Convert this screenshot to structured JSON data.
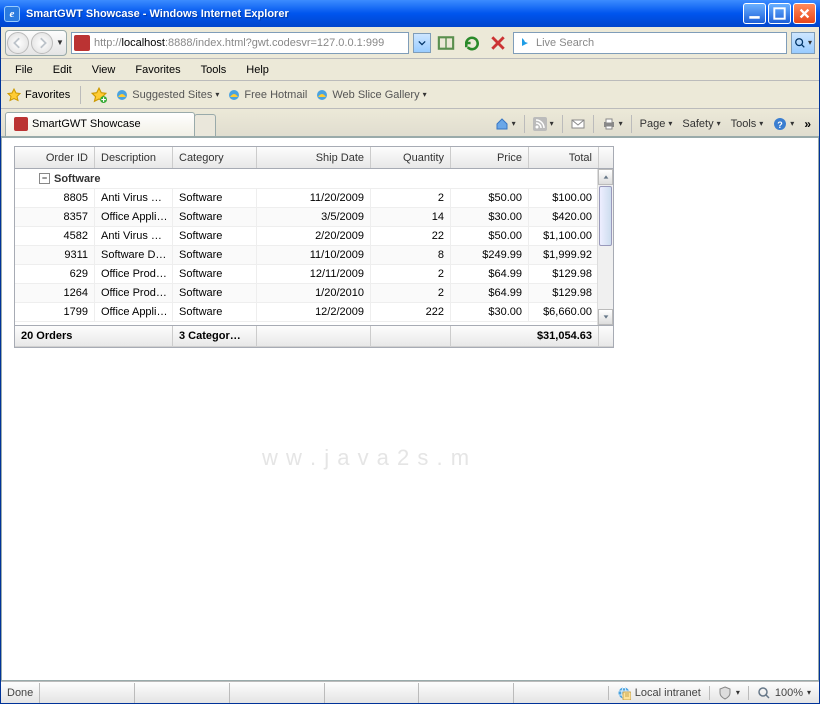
{
  "window": {
    "title": "SmartGWT Showcase - Windows Internet Explorer"
  },
  "nav": {
    "url_prefix": "http://",
    "url_host": "localhost",
    "url_rest": ":8888/index.html?gwt.codesvr=127.0.0.1:999",
    "search_placeholder": "Live Search"
  },
  "menu": {
    "items": [
      "File",
      "Edit",
      "View",
      "Favorites",
      "Tools",
      "Help"
    ]
  },
  "favbar": {
    "label": "Favorites",
    "suggested": "Suggested Sites",
    "hotmail": "Free Hotmail",
    "slice": "Web Slice Gallery"
  },
  "tab": {
    "title": "SmartGWT Showcase"
  },
  "cmdbar": {
    "page": "Page",
    "safety": "Safety",
    "tools": "Tools"
  },
  "grid": {
    "headers": [
      "Order ID",
      "Description",
      "Category",
      "Ship Date",
      "Quantity",
      "Price",
      "Total"
    ],
    "group": "Software",
    "rows": [
      {
        "id": "8805",
        "desc": "Anti Virus …",
        "cat": "Software",
        "date": "11/20/2009",
        "qty": "2",
        "price": "$50.00",
        "total": "$100.00"
      },
      {
        "id": "8357",
        "desc": "Office Appli…",
        "cat": "Software",
        "date": "3/5/2009",
        "qty": "14",
        "price": "$30.00",
        "total": "$420.00"
      },
      {
        "id": "4582",
        "desc": "Anti Virus …",
        "cat": "Software",
        "date": "2/20/2009",
        "qty": "22",
        "price": "$50.00",
        "total": "$1,100.00"
      },
      {
        "id": "9311",
        "desc": "Software D…",
        "cat": "Software",
        "date": "11/10/2009",
        "qty": "8",
        "price": "$249.99",
        "total": "$1,999.92"
      },
      {
        "id": "629",
        "desc": "Office Prod…",
        "cat": "Software",
        "date": "12/11/2009",
        "qty": "2",
        "price": "$64.99",
        "total": "$129.98"
      },
      {
        "id": "1264",
        "desc": "Office Prod…",
        "cat": "Software",
        "date": "1/20/2010",
        "qty": "2",
        "price": "$64.99",
        "total": "$129.98"
      },
      {
        "id": "1799",
        "desc": "Office Appli…",
        "cat": "Software",
        "date": "12/2/2009",
        "qty": "222",
        "price": "$30.00",
        "total": "$6,660.00"
      }
    ],
    "footer": {
      "orders": "20 Orders",
      "categories": "3 Categor…",
      "total": "$31,054.63"
    }
  },
  "watermark": "w   w  .  j  a v a 2 s  .       m",
  "status": {
    "left": "Done",
    "zone": "Local intranet",
    "zoom": "100%"
  }
}
